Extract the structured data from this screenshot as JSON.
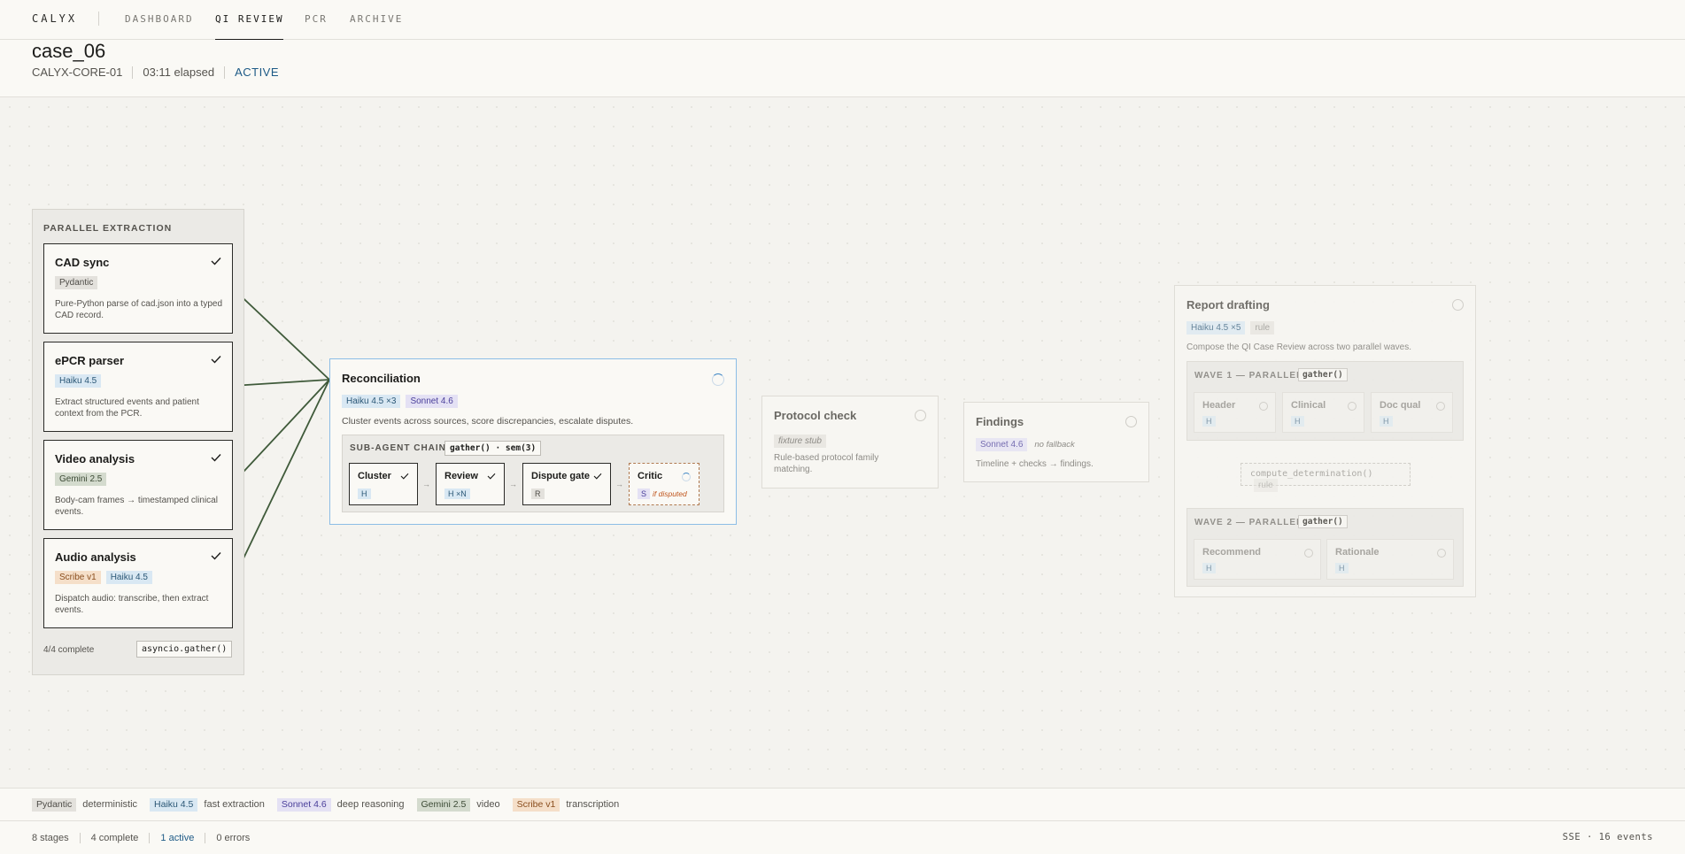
{
  "nav": {
    "brand": "CALYX",
    "items": [
      "DASHBOARD",
      "QI REVIEW",
      "PCR",
      "ARCHIVE"
    ],
    "active": "QI REVIEW"
  },
  "header": {
    "title": "case_06",
    "unit": "CALYX-CORE-01",
    "elapsed": "03:11 elapsed",
    "status": "ACTIVE"
  },
  "extraction": {
    "title": "PARALLEL EXTRACTION",
    "cards": [
      {
        "title": "CAD sync",
        "tags": [
          {
            "label": "Pydantic",
            "kind": "pyd"
          }
        ],
        "desc": "Pure-Python parse of cad.json into a typed CAD record."
      },
      {
        "title": "ePCR parser",
        "tags": [
          {
            "label": "Haiku 4.5",
            "kind": "haiku"
          }
        ],
        "desc": "Extract structured events and patient context from the PCR."
      },
      {
        "title": "Video analysis",
        "tags": [
          {
            "label": "Gemini 2.5",
            "kind": "gemini"
          }
        ],
        "desc": "Body-cam frames → timestamped clinical events."
      },
      {
        "title": "Audio analysis",
        "tags": [
          {
            "label": "Scribe v1",
            "kind": "scribe"
          },
          {
            "label": "Haiku 4.5",
            "kind": "haiku"
          }
        ],
        "desc": "Dispatch audio: transcribe, then extract events."
      }
    ],
    "footer": "4/4 complete",
    "gather": "asyncio.gather()"
  },
  "reconciliation": {
    "title": "Reconciliation",
    "tags": [
      {
        "label": "Haiku 4.5 ×3",
        "kind": "haiku"
      },
      {
        "label": "Sonnet 4.6",
        "kind": "sonnet"
      }
    ],
    "desc": "Cluster events across sources, score discrepancies, escalate disputes.",
    "chain_title": "SUB-AGENT CHAIN",
    "chain_code": "gather() · sem(3)",
    "steps": [
      {
        "title": "Cluster",
        "tag": "H",
        "kind": "haiku"
      },
      {
        "title": "Review",
        "tag": "H ×N",
        "kind": "haiku"
      },
      {
        "title": "Dispute gate",
        "tag": "R",
        "kind": "pyd"
      },
      {
        "title": "Critic",
        "tag": "S",
        "kind": "sonnet",
        "note": "if disputed"
      }
    ]
  },
  "protocol": {
    "title": "Protocol check",
    "tag": "fixture stub",
    "desc": "Rule-based protocol family matching."
  },
  "findings": {
    "title": "Findings",
    "tag": "Sonnet 4.6",
    "fallback": "no fallback",
    "desc": "Timeline + checks → findings."
  },
  "report": {
    "title": "Report drafting",
    "tags": [
      {
        "label": "Haiku 4.5 ×5",
        "kind": "haiku"
      },
      {
        "label": "rule",
        "kind": "rule"
      }
    ],
    "desc": "Compose the QI Case Review across two parallel waves.",
    "wave1": {
      "title": "WAVE 1 — PARALLEL",
      "code": "gather()",
      "cards": [
        "Header",
        "Clinical",
        "Doc qual"
      ],
      "tag": "H"
    },
    "compute": "compute_determination()",
    "compute_tag": "rule",
    "wave2": {
      "title": "WAVE 2 — PARALLEL",
      "code": "gather()",
      "cards": [
        "Recommend",
        "Rationale"
      ],
      "tag": "H"
    }
  },
  "legend": [
    {
      "tag": "Pydantic",
      "kind": "pyd",
      "label": "deterministic"
    },
    {
      "tag": "Haiku 4.5",
      "kind": "haiku",
      "label": "fast extraction"
    },
    {
      "tag": "Sonnet 4.6",
      "kind": "sonnet",
      "label": "deep reasoning"
    },
    {
      "tag": "Gemini 2.5",
      "kind": "gemini",
      "label": "video"
    },
    {
      "tag": "Scribe v1",
      "kind": "scribe",
      "label": "transcription"
    }
  ],
  "status": {
    "stages": "8 stages",
    "complete": "4 complete",
    "active": "1 active",
    "errors": "0 errors",
    "sse": "SSE · 16 events"
  },
  "colors": {
    "accent": "#1d5a86",
    "wire": "#3f5a3a",
    "active_border": "#8cbde6"
  }
}
